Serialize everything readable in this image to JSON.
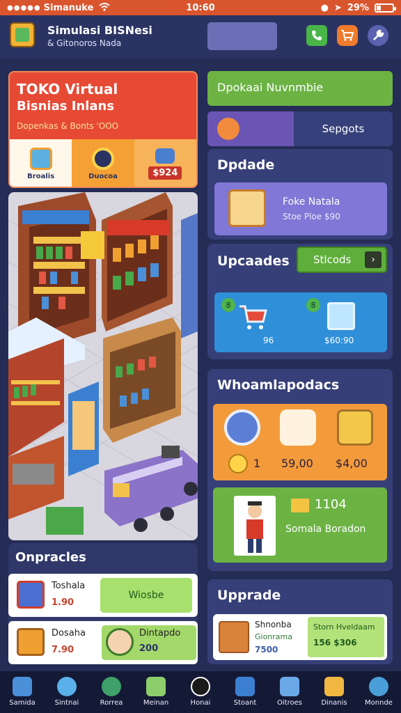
{
  "status_bar": {
    "signal": "●●●●●",
    "carrier": "Simanuke",
    "time": "10:60",
    "battery": "29%",
    "battery_level": 0.29
  },
  "header": {
    "title": "Simulasi BISNesi",
    "subtitle": "& Gitonoros Nada"
  },
  "hero": {
    "title_line1": "TOKO Virtual",
    "title_line2": "Bisnias Inlans",
    "caption": "Dopenkas & Bonts 'OOO",
    "tiles": [
      {
        "label": "Broalis"
      },
      {
        "label": "Duocoa"
      },
      {
        "price": "$924"
      }
    ]
  },
  "upgrades_left": {
    "heading": "Onpracles",
    "items": [
      {
        "name": "Toshala",
        "price": "1.90",
        "action": "Wiosbe"
      },
      {
        "name": "Dosaha",
        "price": "7.90",
        "person_label": "Dintapdo",
        "person_value": "200"
      }
    ]
  },
  "right": {
    "green_bar": "Dpokaai Nuvnmbie",
    "segment_label": "Sepgots",
    "card1": {
      "heading": "Dpdade",
      "item_name": "Foke Natala",
      "item_sub": "Stoe Ploe $90"
    },
    "card2": {
      "heading": "Upcaades",
      "button": "Stlcods",
      "badge1": "8",
      "badge2": "8",
      "value1": "96",
      "value2": "$60:90"
    },
    "card3": {
      "heading": "Whoamlapodacs",
      "values": [
        "1",
        "59,00",
        "$4,00"
      ],
      "count": "1104",
      "sub": "Somala Boradon"
    },
    "card4": {
      "heading": "Upprade",
      "name": "Shnonba",
      "sub": "Gionrama",
      "price": "7500",
      "box_line1": "Storn Hveldaam",
      "box_line2": "156 $306"
    }
  },
  "nav": [
    {
      "label": "Samida"
    },
    {
      "label": "Sintnai"
    },
    {
      "label": "Rorrea"
    },
    {
      "label": "Meinan"
    },
    {
      "label": "Honai"
    },
    {
      "label": "Stoant"
    },
    {
      "label": "Oitroes"
    },
    {
      "label": "Dinanis"
    },
    {
      "label": "Monnde"
    }
  ]
}
